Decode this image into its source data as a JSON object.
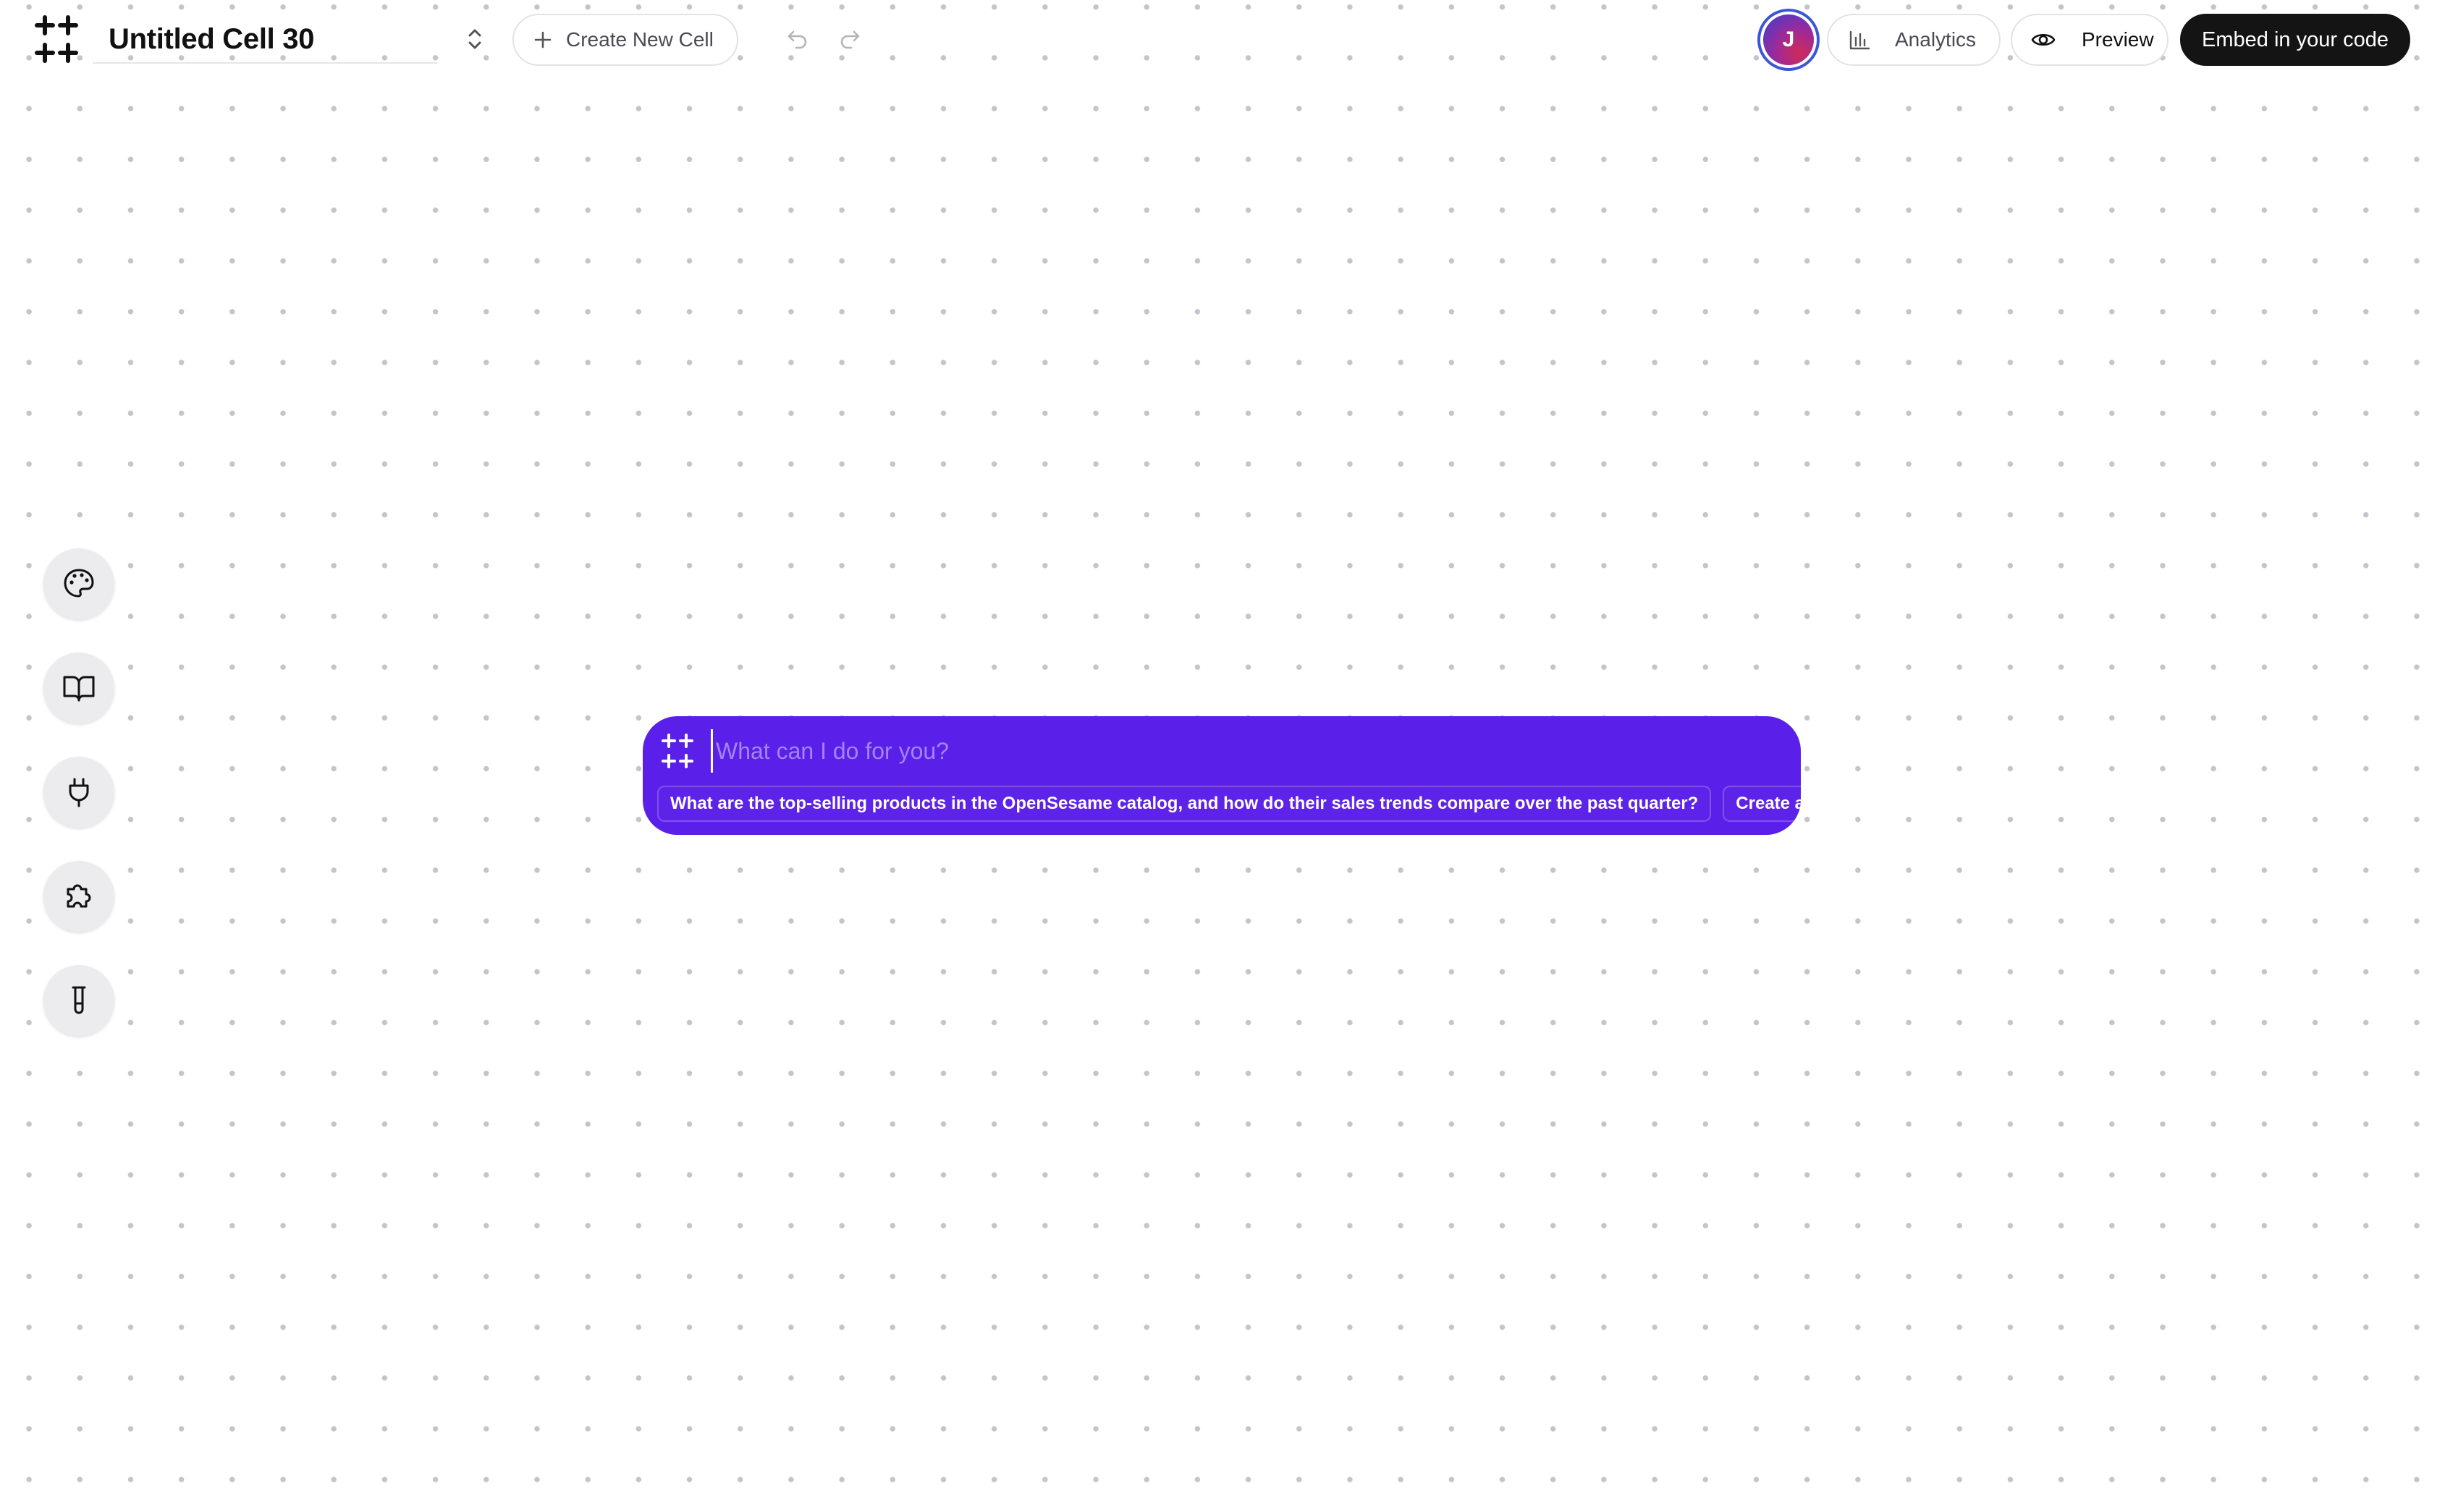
{
  "app": {
    "title": "Untitled Cell 30",
    "accent_color": "#5a1fe8",
    "background_dot_color": "#c4c4cc"
  },
  "toolbar": {
    "create_label": "Create New Cell",
    "undo_icon": "undo-icon",
    "redo_icon": "redo-icon"
  },
  "user": {
    "initial": "J"
  },
  "header_actions": {
    "analytics_label": "Analytics",
    "preview_label": "Preview",
    "embed_label": "Embed in your code"
  },
  "sidebar": {
    "items": [
      {
        "icon": "palette-icon"
      },
      {
        "icon": "book-icon"
      },
      {
        "icon": "plug-icon"
      },
      {
        "icon": "puzzle-icon"
      },
      {
        "icon": "test-tube-icon"
      }
    ]
  },
  "prompt": {
    "placeholder": "What can I do for you?",
    "value": "",
    "suggestions": [
      "What are the top-selling products in the OpenSesame catalog, and how do their sales trends compare over the past quarter?",
      "Create a re"
    ]
  }
}
